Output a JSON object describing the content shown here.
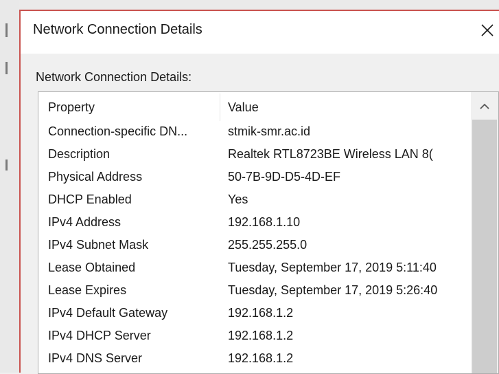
{
  "window": {
    "title": "Network Connection Details"
  },
  "group": {
    "label": "Network Connection Details:"
  },
  "table": {
    "columns": [
      "Property",
      "Value"
    ],
    "rows": [
      {
        "property": "Connection-specific DN...",
        "value": "stmik-smr.ac.id"
      },
      {
        "property": "Description",
        "value": "Realtek RTL8723BE Wireless LAN 8("
      },
      {
        "property": "Physical Address",
        "value": "50-7B-9D-D5-4D-EF"
      },
      {
        "property": "DHCP Enabled",
        "value": "Yes"
      },
      {
        "property": "IPv4 Address",
        "value": "192.168.1.10"
      },
      {
        "property": "IPv4 Subnet Mask",
        "value": "255.255.255.0"
      },
      {
        "property": "Lease Obtained",
        "value": "Tuesday, September 17, 2019 5:11:40"
      },
      {
        "property": "Lease Expires",
        "value": "Tuesday, September 17, 2019 5:26:40"
      },
      {
        "property": "IPv4 Default Gateway",
        "value": "192.168.1.2"
      },
      {
        "property": "IPv4 DHCP Server",
        "value": "192.168.1.2"
      },
      {
        "property": "IPv4 DNS Server",
        "value": "192.168.1.2"
      }
    ]
  },
  "icons": {
    "close": "close-icon",
    "scroll_up": "chevron-up-icon"
  },
  "colors": {
    "dialog_border": "#c9534f",
    "background": "#f0f0f0",
    "scroll_thumb": "#cdcdcd"
  }
}
